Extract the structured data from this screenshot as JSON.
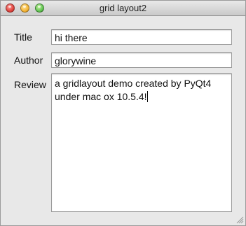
{
  "window": {
    "title": "grid layout2"
  },
  "form": {
    "title_label": "Title",
    "title_value": "hi there",
    "author_label": "Author",
    "author_value": "glorywine",
    "review_label": "Review",
    "review_value": "a gridlayout demo created by PyQt4\nunder mac ox 10.5.4!"
  }
}
